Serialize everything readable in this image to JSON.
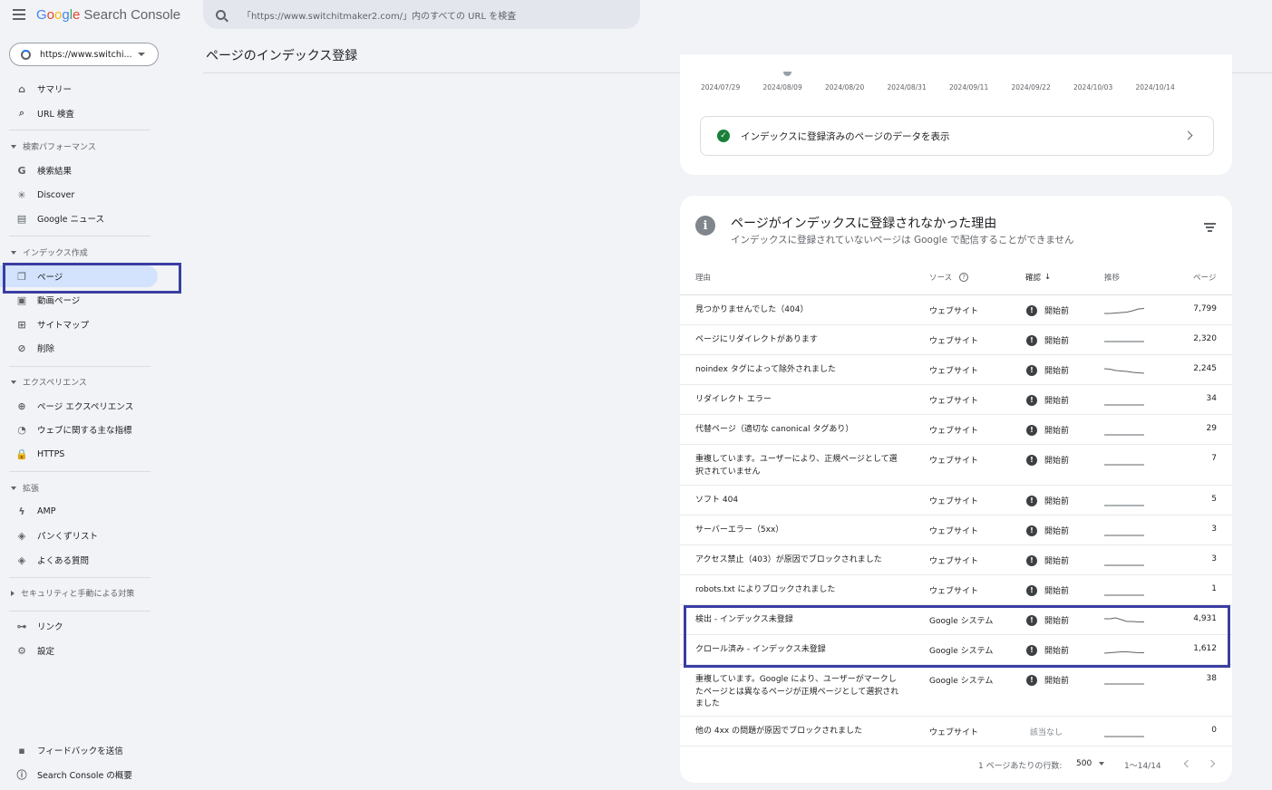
{
  "app": {
    "brand": [
      "G",
      "o",
      "o",
      "g",
      "l",
      "e"
    ],
    "product": "Search Console"
  },
  "search": {
    "placeholder": "「https://www.switchitmaker2.com/」内のすべての URL を検査"
  },
  "property": {
    "label": "https://www.switchi..."
  },
  "sidebar": {
    "items": [
      {
        "label": "サマリー",
        "icon": "home-icon",
        "glyph": "⌂"
      },
      {
        "label": "URL 検査",
        "icon": "search-icon",
        "glyph": "⌕"
      }
    ],
    "sections": [
      {
        "label": "検索パフォーマンス",
        "items": [
          {
            "label": "検索結果",
            "icon": "google-g-icon",
            "glyph": "G"
          },
          {
            "label": "Discover",
            "icon": "asterisk-icon",
            "glyph": "✳"
          },
          {
            "label": "Google ニュース",
            "icon": "newspaper-icon",
            "glyph": "▤"
          }
        ]
      },
      {
        "label": "インデックス作成",
        "items": [
          {
            "label": "ページ",
            "icon": "pages-icon",
            "glyph": "❐"
          },
          {
            "label": "動画ページ",
            "icon": "video-page-icon",
            "glyph": "▣"
          },
          {
            "label": "サイトマップ",
            "icon": "sitemap-icon",
            "glyph": "⊞"
          },
          {
            "label": "削除",
            "icon": "eye-off-icon",
            "glyph": "⊘"
          }
        ]
      },
      {
        "label": "エクスペリエンス",
        "items": [
          {
            "label": "ページ エクスペリエンス",
            "icon": "plus-circle-icon",
            "glyph": "⊕"
          },
          {
            "label": "ウェブに関する主な指標",
            "icon": "speed-gauge-icon",
            "glyph": "◔"
          },
          {
            "label": "HTTPS",
            "icon": "lock-icon",
            "glyph": "🔒"
          }
        ]
      },
      {
        "label": "拡張",
        "items": [
          {
            "label": "AMP",
            "icon": "bolt-icon",
            "glyph": "ϟ"
          },
          {
            "label": "パンくずリスト",
            "icon": "layers-icon",
            "glyph": "◈"
          },
          {
            "label": "よくある質問",
            "icon": "layers-icon",
            "glyph": "◈"
          }
        ]
      }
    ],
    "security": {
      "label": "セキュリティと手動による対策"
    },
    "bottom": [
      {
        "label": "リンク",
        "icon": "links-icon",
        "glyph": "⊶"
      },
      {
        "label": "設定",
        "icon": "gear-icon",
        "glyph": "⚙"
      }
    ],
    "footer": [
      {
        "label": "フィードバックを送信",
        "icon": "feedback-icon",
        "glyph": "▪"
      },
      {
        "label": "Search Console の概要",
        "icon": "info-icon",
        "glyph": "ⓘ"
      }
    ]
  },
  "page": {
    "title": "ページのインデックス登録"
  },
  "timeline": {
    "dates": [
      "2024/07/29",
      "2024/08/09",
      "2024/08/20",
      "2024/08/31",
      "2024/09/11",
      "2024/09/22",
      "2024/10/03",
      "2024/10/14"
    ]
  },
  "indexed_link": {
    "label": "インデックスに登録済みのページのデータを表示"
  },
  "reasons": {
    "title": "ページがインデックスに登録されなかった理由",
    "subtitle": "インデックスに登録されていないページは Google で配信することができません",
    "headers": {
      "reason": "理由",
      "source": "ソース",
      "validation": "確認",
      "trend": "推移",
      "pages": "ページ"
    },
    "rows": [
      {
        "reason": "見つかりませんでした（404）",
        "source": "ウェブサイト",
        "status": "開始前",
        "pages": "7,799",
        "trend": [
          0.3,
          0.3,
          0.35,
          0.4,
          0.45,
          0.6,
          0.8,
          0.85
        ],
        "lines": 1
      },
      {
        "reason": "ページにリダイレクトがあります",
        "source": "ウェブサイト",
        "status": "開始前",
        "pages": "2,320",
        "trend": [
          0.5,
          0.5,
          0.5,
          0.5,
          0.5,
          0.5,
          0.5,
          0.5
        ],
        "lines": 1
      },
      {
        "reason": "noindex タグによって除外されました",
        "source": "ウェブサイト",
        "status": "開始前",
        "pages": "2,245",
        "trend": [
          0.8,
          0.75,
          0.6,
          0.55,
          0.5,
          0.4,
          0.35,
          0.3
        ],
        "lines": 1
      },
      {
        "reason": "リダイレクト エラー",
        "source": "ウェブサイト",
        "status": "開始前",
        "pages": "34",
        "trend": [
          0.1,
          0.1,
          0.1,
          0.1,
          0.1,
          0.1,
          0.1,
          0.1
        ],
        "lines": 1
      },
      {
        "reason": "代替ページ（適切な canonical タグあり）",
        "source": "ウェブサイト",
        "status": "開始前",
        "pages": "29",
        "trend": [
          0.1,
          0.1,
          0.1,
          0.1,
          0.1,
          0.1,
          0.1,
          0.1
        ],
        "lines": 1
      },
      {
        "reason": "重複しています。ユーザーにより、正規ページとして選択されていません",
        "source": "ウェブサイト",
        "status": "開始前",
        "pages": "7",
        "trend": [
          0.1,
          0.1,
          0.1,
          0.1,
          0.1,
          0.1,
          0.1,
          0.1
        ],
        "lines": 2
      },
      {
        "reason": "ソフト 404",
        "source": "ウェブサイト",
        "status": "開始前",
        "pages": "5",
        "trend": [
          0.1,
          0.1,
          0.1,
          0.1,
          0.1,
          0.1,
          0.1,
          0.1
        ],
        "lines": 1
      },
      {
        "reason": "サーバーエラー（5xx）",
        "source": "ウェブサイト",
        "status": "開始前",
        "pages": "3",
        "trend": [
          0.1,
          0.1,
          0.1,
          0.1,
          0.1,
          0.1,
          0.1,
          0.1
        ],
        "lines": 1
      },
      {
        "reason": "アクセス禁止（403）が原因でブロックされました",
        "source": "ウェブサイト",
        "status": "開始前",
        "pages": "3",
        "trend": [
          0.1,
          0.1,
          0.1,
          0.1,
          0.1,
          0.1,
          0.1,
          0.1
        ],
        "lines": 1
      },
      {
        "reason": "robots.txt によりブロックされました",
        "source": "ウェブサイト",
        "status": "開始前",
        "pages": "1",
        "trend": [
          0.1,
          0.1,
          0.1,
          0.1,
          0.1,
          0.1,
          0.1,
          0.1
        ],
        "lines": 1
      },
      {
        "reason": "検出 - インデックス未登録",
        "source": "Google システム",
        "status": "開始前",
        "pages": "4,931",
        "trend": [
          0.8,
          0.8,
          0.9,
          0.7,
          0.5,
          0.5,
          0.45,
          0.45
        ],
        "lines": 1
      },
      {
        "reason": "クロール済み - インデックス未登録",
        "source": "Google システム",
        "status": "開始前",
        "pages": "1,612",
        "trend": [
          0.3,
          0.35,
          0.4,
          0.45,
          0.45,
          0.4,
          0.35,
          0.35
        ],
        "lines": 1
      },
      {
        "reason": "重複しています。Google により、ユーザーがマークしたページとは異なるページが正規ページとして選択されました",
        "source": "Google システム",
        "status": "開始前",
        "pages": "38",
        "trend": [
          0.2,
          0.2,
          0.2,
          0.2,
          0.2,
          0.2,
          0.2,
          0.2
        ],
        "lines": 3
      },
      {
        "reason": "他の 4xx の問題が原因でブロックされました",
        "source": "ウェブサイト",
        "status": "該当なし",
        "pages": "0",
        "trend": [
          0.1,
          0.1,
          0.1,
          0.1,
          0.1,
          0.1,
          0.1,
          0.1
        ],
        "lines": 1
      }
    ]
  },
  "pagination": {
    "rows_label": "1 ページあたりの行数:",
    "rows_value": "500",
    "range": "1〜14/14"
  },
  "colors": {
    "accent": "#1a73e8",
    "highlight": "#3a3ea3",
    "active": "#d3e3fd"
  }
}
